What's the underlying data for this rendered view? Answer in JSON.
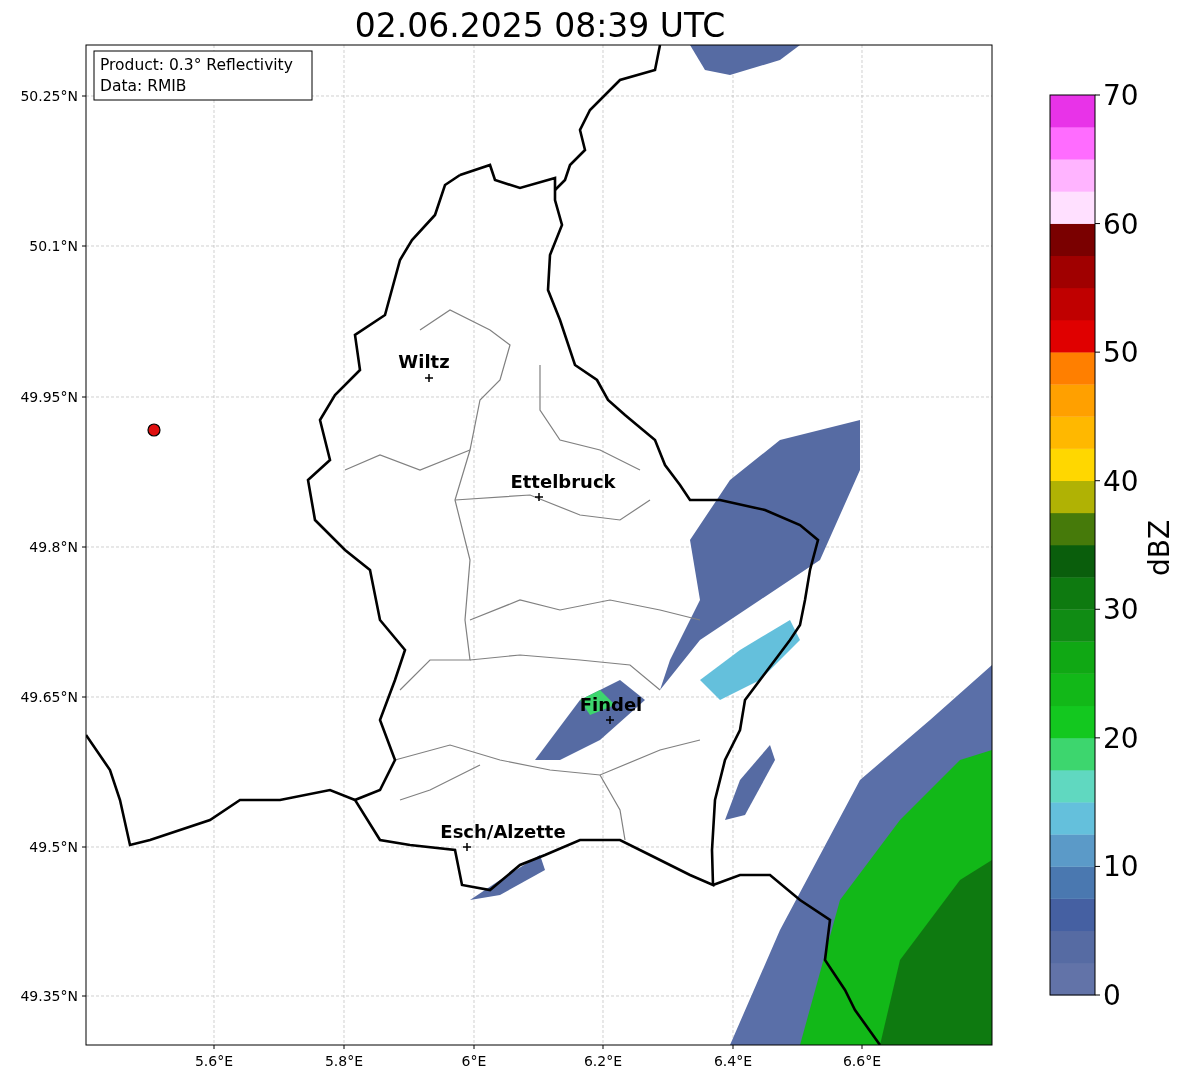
{
  "title": "02.06.2025 08:39 UTC",
  "info_box": [
    "Product: 0.3° Reflectivity",
    "Data: RMIB"
  ],
  "y_ticks": [
    "50.25°N",
    "50.1°N",
    "49.95°N",
    "49.8°N",
    "49.65°N",
    "49.5°N",
    "49.35°N"
  ],
  "x_ticks": [
    "5.6°E",
    "5.8°E",
    "6°E",
    "6.2°E",
    "6.4°E",
    "6.6°E"
  ],
  "cities": [
    {
      "name": "Wiltz"
    },
    {
      "name": "Ettelbruck"
    },
    {
      "name": "Findel"
    },
    {
      "name": "Esch/Alzette"
    }
  ],
  "colorbar": {
    "label": "dBZ",
    "ticks": [
      "70",
      "60",
      "50",
      "40",
      "30",
      "20",
      "10",
      "0"
    ],
    "bins": [
      {
        "color": "#6273a8"
      },
      {
        "color": "#566ba3"
      },
      {
        "color": "#4560a2"
      },
      {
        "color": "#4a78b0"
      },
      {
        "color": "#5b9ac8"
      },
      {
        "color": "#64c0dc"
      },
      {
        "color": "#60d8c0"
      },
      {
        "color": "#3dd66e"
      },
      {
        "color": "#13c81f"
      },
      {
        "color": "#12b818"
      },
      {
        "color": "#10a814"
      },
      {
        "color": "#108c14"
      },
      {
        "color": "#0e7a10"
      },
      {
        "color": "#0a5e0c"
      },
      {
        "color": "#467a0a"
      },
      {
        "color": "#b0b204"
      },
      {
        "color": "#ffd700"
      },
      {
        "color": "#ffb800"
      },
      {
        "color": "#ffa000"
      },
      {
        "color": "#ff7f00"
      },
      {
        "color": "#e00000"
      },
      {
        "color": "#c00000"
      },
      {
        "color": "#a00000"
      },
      {
        "color": "#7a0000"
      },
      {
        "color": "#ffe0ff"
      },
      {
        "color": "#ffb4ff"
      },
      {
        "color": "#ff6cff"
      },
      {
        "color": "#e833e8"
      }
    ]
  }
}
